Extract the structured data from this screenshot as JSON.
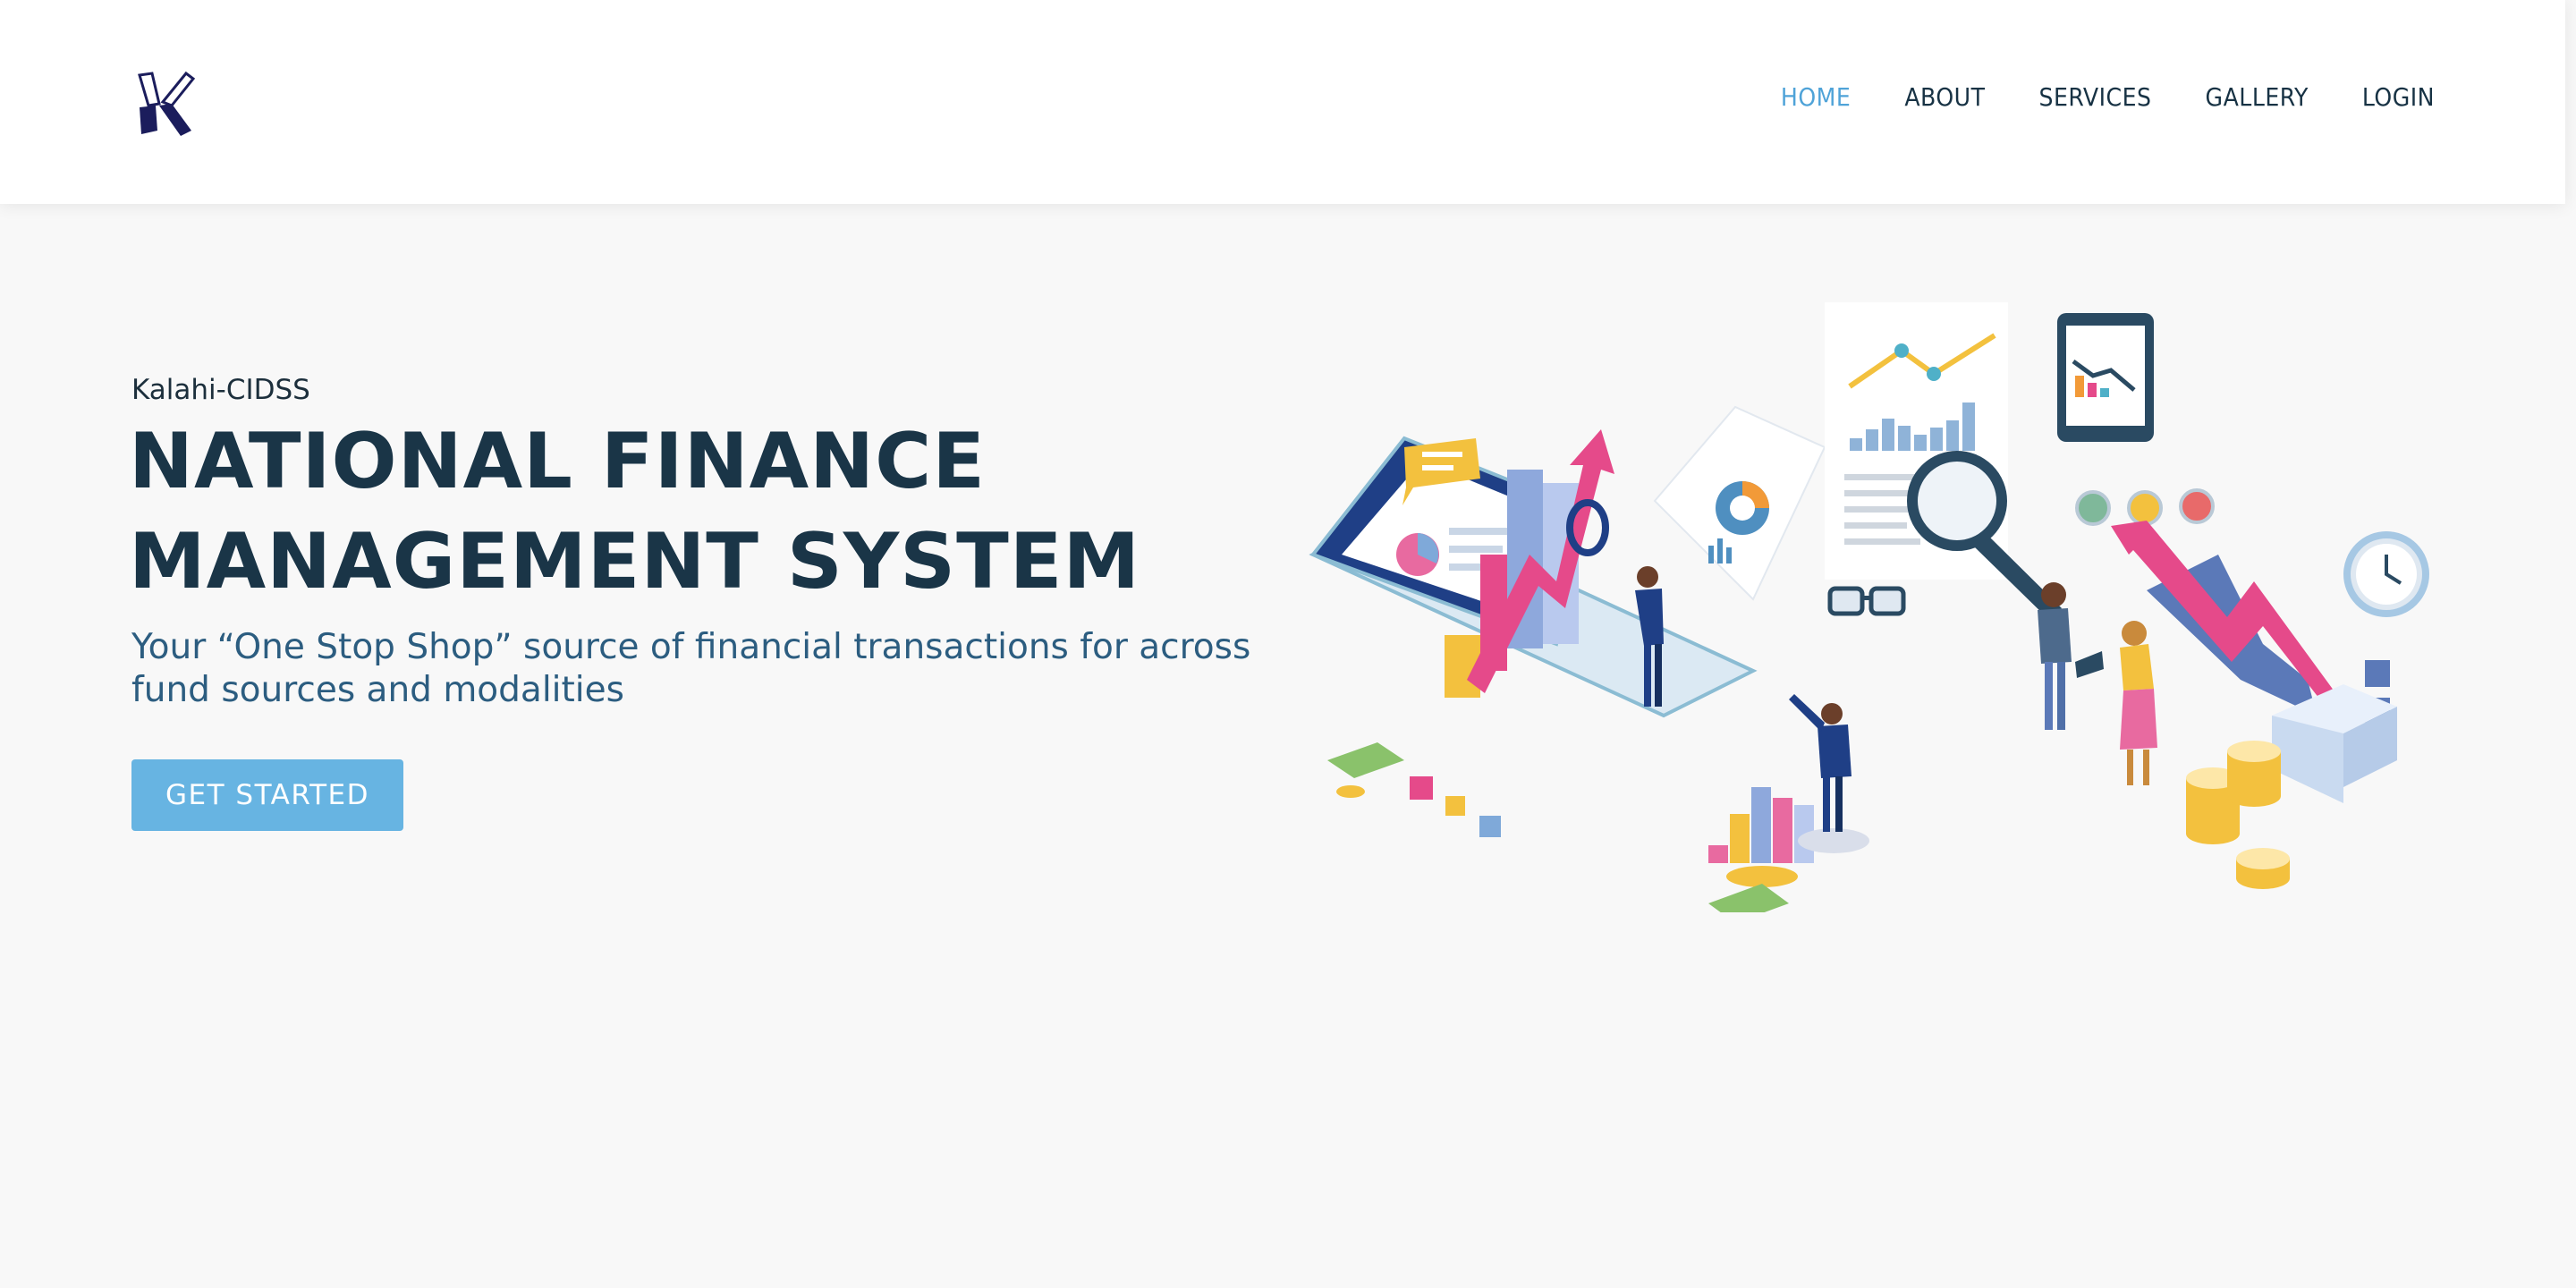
{
  "brand": {
    "logo_icon": "kalahi-k-logo"
  },
  "nav": {
    "items": [
      {
        "label": "HOME",
        "active": true
      },
      {
        "label": "ABOUT"
      },
      {
        "label": "SERVICES"
      },
      {
        "label": "GALLERY"
      },
      {
        "label": "LOGIN"
      }
    ]
  },
  "hero": {
    "eyebrow": "Kalahi-CIDSS",
    "title_line1": "NATIONAL FINANCE",
    "title_line2": "MANAGEMENT SYSTEM",
    "subtitle": "Your “One Stop Shop” source of financial transactions for across fund sources and modalities",
    "cta_label": "GET STARTED"
  },
  "colors": {
    "nav_active": "#4fa3d8",
    "title": "#1a3547",
    "subtitle": "#2c5d80",
    "cta_bg": "#67b4e2",
    "page_bg": "#f8f8f8"
  }
}
